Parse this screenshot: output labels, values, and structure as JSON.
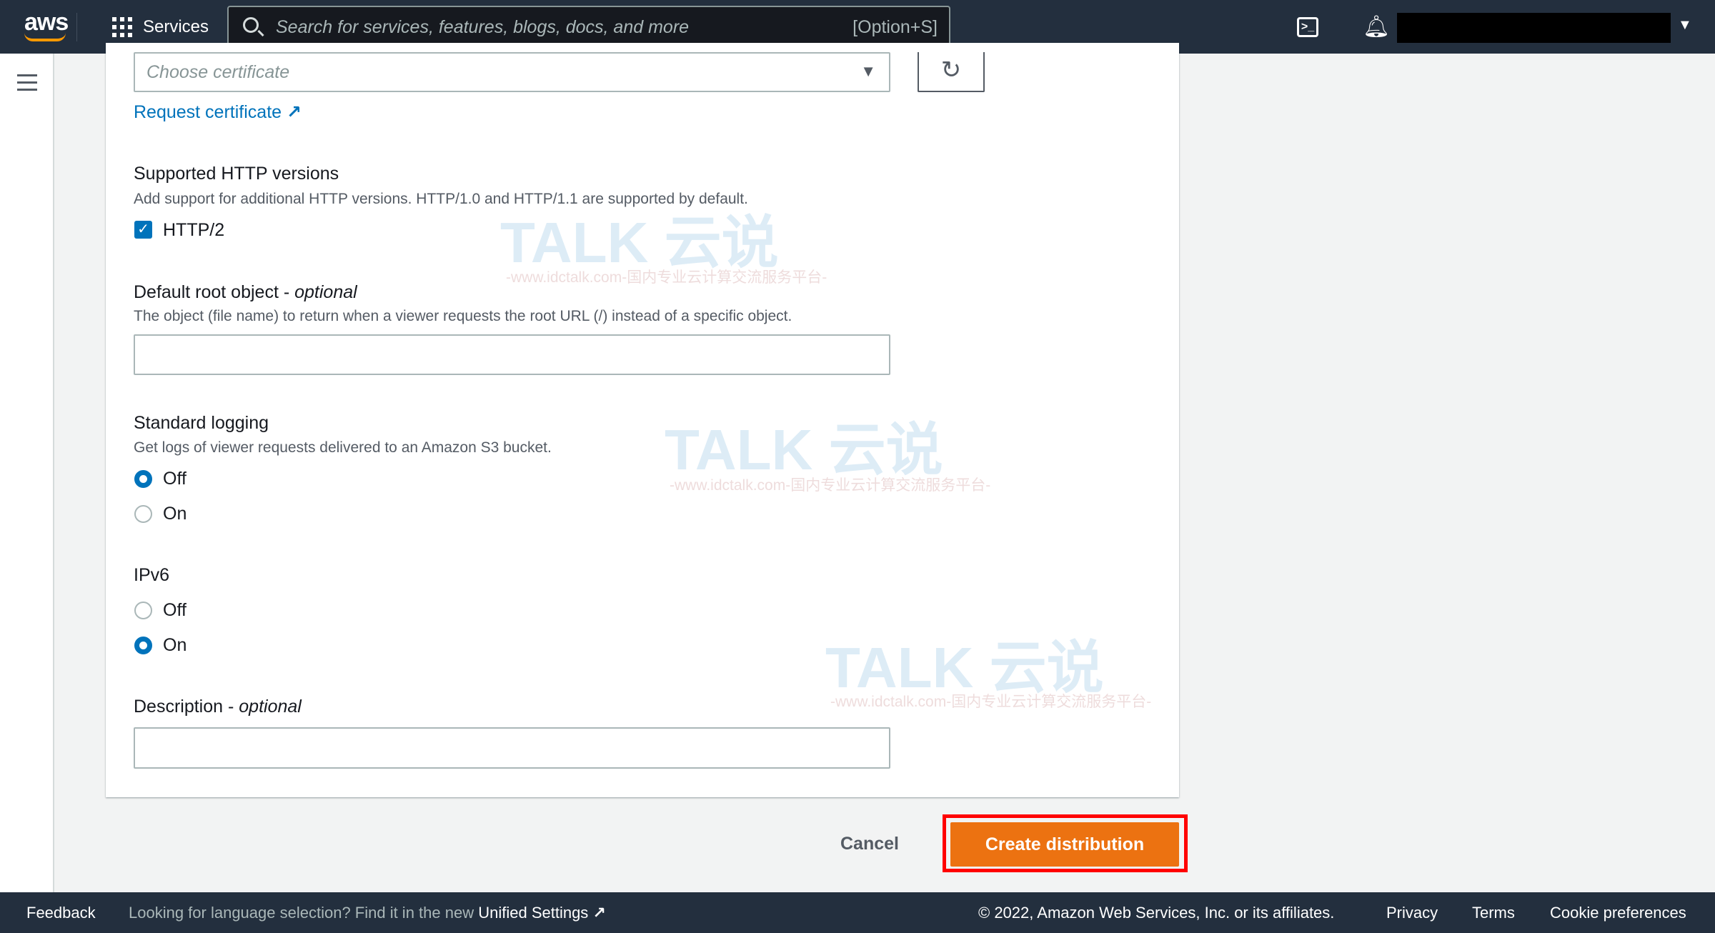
{
  "topbar": {
    "logo": "aws",
    "services": "Services",
    "search_placeholder": "Search for services, features, blogs, docs, and more",
    "search_shortcut": "[Option+S]"
  },
  "form": {
    "certificate": {
      "placeholder": "Choose certificate",
      "request_link": "Request certificate"
    },
    "http": {
      "label": "Supported HTTP versions",
      "description": "Add support for additional HTTP versions. HTTP/1.0 and HTTP/1.1 are supported by default.",
      "option": "HTTP/2",
      "checked": true
    },
    "root": {
      "label": "Default root object - ",
      "optional": "optional",
      "description": "The object (file name) to return when a viewer requests the root URL (/) instead of a specific object.",
      "value": ""
    },
    "logging": {
      "label": "Standard logging",
      "description": "Get logs of viewer requests delivered to an Amazon S3 bucket.",
      "options": [
        "Off",
        "On"
      ],
      "selected": "Off"
    },
    "ipv6": {
      "label": "IPv6",
      "options": [
        "Off",
        "On"
      ],
      "selected": "On"
    },
    "description": {
      "label": "Description - ",
      "optional": "optional",
      "value": ""
    }
  },
  "actions": {
    "cancel": "Cancel",
    "create": "Create distribution",
    "highlight_color": "#ff0000",
    "primary_color": "#ec7211"
  },
  "watermark": {
    "brand": "TALK 云说",
    "tagline": "-www.idctalk.com-国内专业云计算交流服务平台-"
  },
  "footer": {
    "feedback": "Feedback",
    "language_prompt": "Looking for language selection? Find it in the new ",
    "unified_settings": "Unified Settings",
    "copyright": "© 2022, Amazon Web Services, Inc. or its affiliates.",
    "privacy": "Privacy",
    "terms": "Terms",
    "cookies": "Cookie preferences"
  }
}
